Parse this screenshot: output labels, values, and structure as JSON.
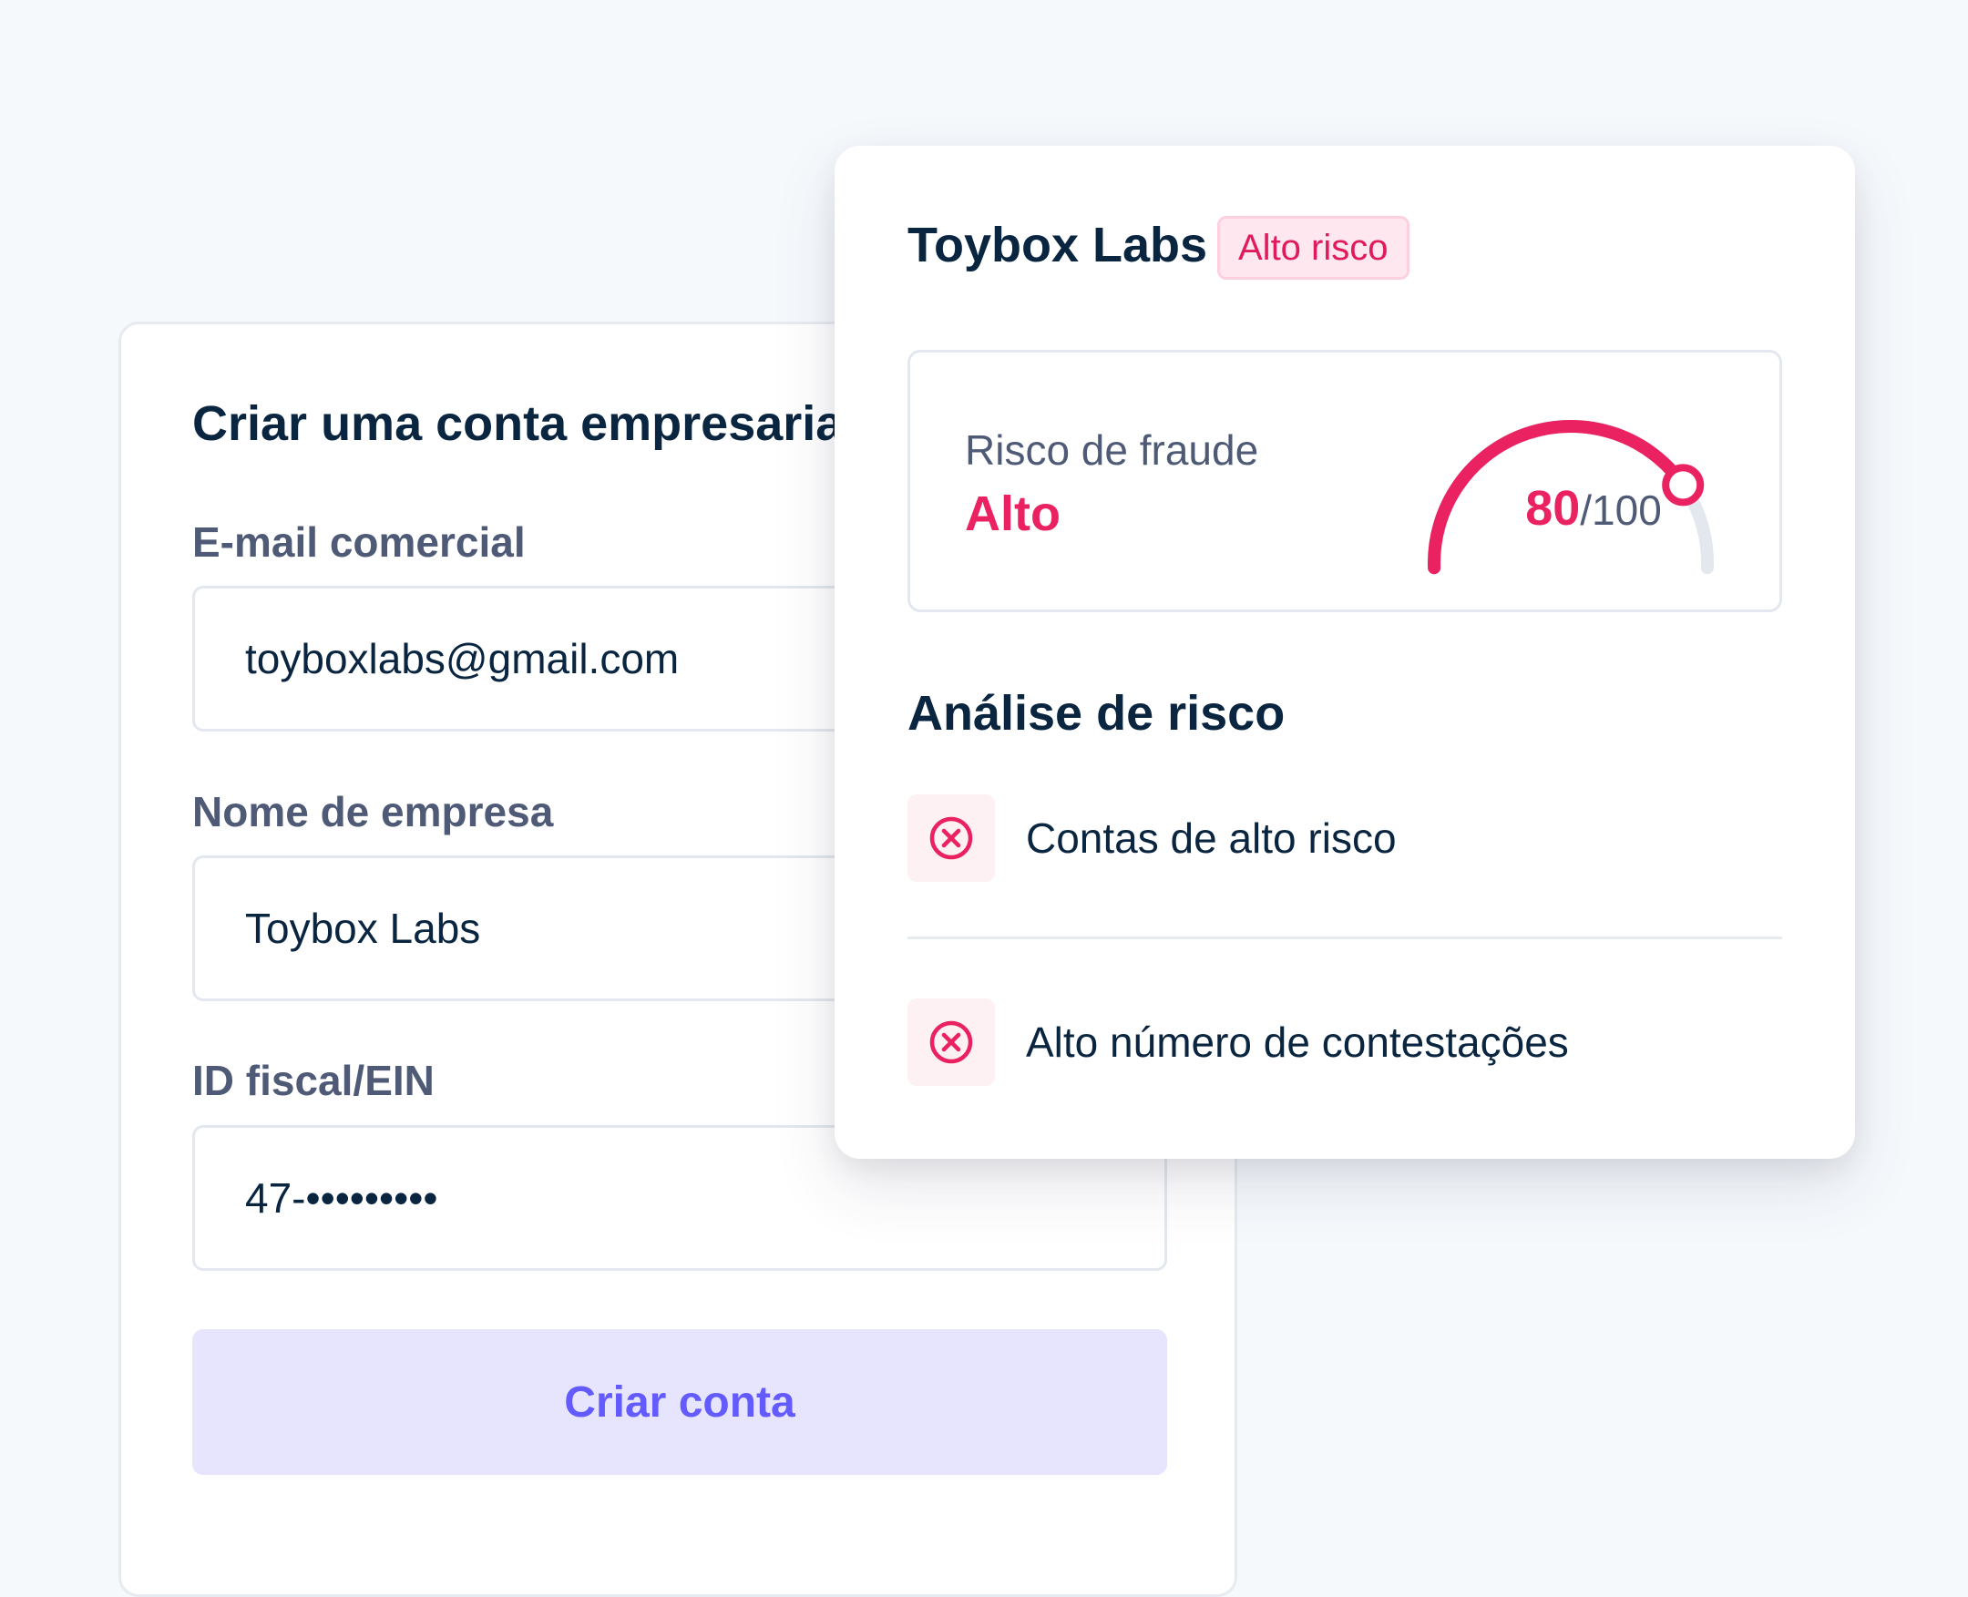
{
  "signup_form": {
    "title": "Criar uma conta empresarial",
    "email": {
      "label": "E-mail comercial",
      "value": "toyboxlabs@gmail.com"
    },
    "company": {
      "label": "Nome de empresa",
      "value": "Toybox Labs"
    },
    "tax_id": {
      "label": "ID fiscal/EIN",
      "value": "47-•••••••••"
    },
    "submit_label": "Criar conta"
  },
  "risk_panel": {
    "company_name": "Toybox Labs",
    "badge": "Alto risco",
    "fraud_score": {
      "label": "Risco de fraude",
      "level": "Alto",
      "value": "80",
      "max": "/100",
      "score_fraction": 0.8
    },
    "analysis": {
      "title": "Análise de risco",
      "items": [
        {
          "icon": "x-circle-icon",
          "text": "Contas de alto risco"
        },
        {
          "icon": "x-circle-icon",
          "text": "Alto número de contestações"
        }
      ]
    }
  },
  "colors": {
    "background": "#f6f9fc",
    "danger": "#ea2261",
    "primary": "#635bff",
    "primary_soft": "#e6e5fd",
    "text_primary": "#0a2540",
    "text_secondary": "#4f5b76",
    "track": "#e3e8ee"
  }
}
